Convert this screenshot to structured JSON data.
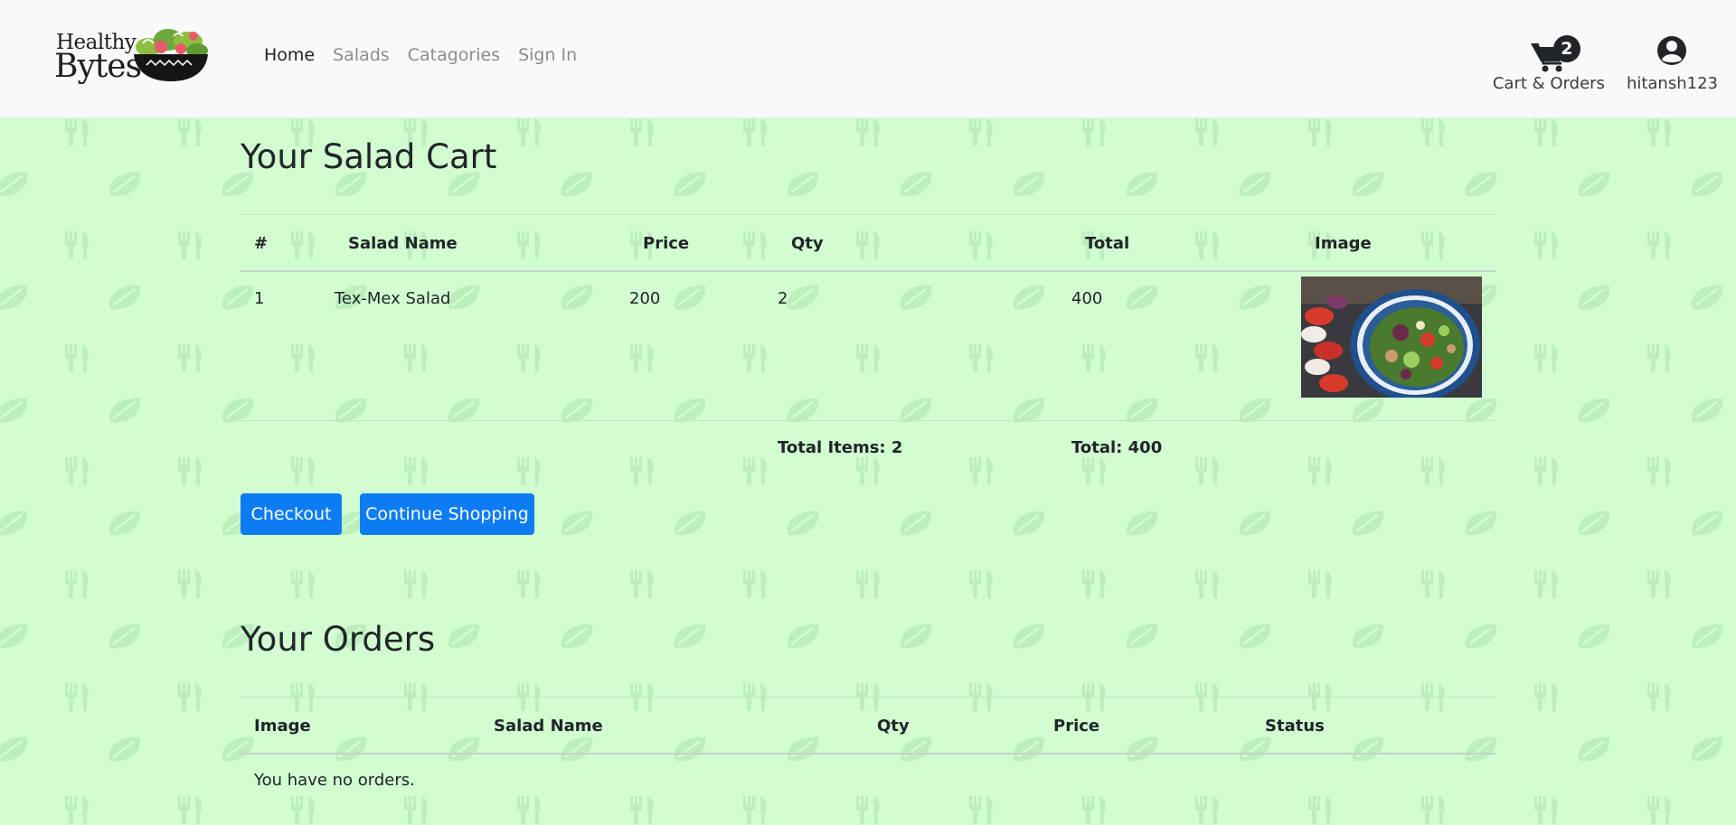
{
  "brand": {
    "line1": "Healthy",
    "line2": "Bytes"
  },
  "nav": {
    "links": [
      "Home",
      "Salads",
      "Catagories",
      "Sign In"
    ],
    "cart_label": "Cart & Orders",
    "cart_count": "2",
    "user_label": "hitansh123"
  },
  "cart": {
    "title": "Your Salad Cart",
    "headers": [
      "#",
      "Salad Name",
      "Price",
      "Qty",
      "Total",
      "Image"
    ],
    "rows": [
      {
        "num": "1",
        "name": "Tex-Mex Salad",
        "price": "200",
        "qty": "2",
        "total": "400"
      }
    ],
    "total_items": "Total Items: 2",
    "total": "Total: 400",
    "checkout_label": "Checkout",
    "continue_label": "Continue Shopping"
  },
  "orders": {
    "title": "Your Orders",
    "headers": [
      "Image",
      "Salad Name",
      "Qty",
      "Price",
      "Status"
    ],
    "empty_text": "You have no orders."
  },
  "colors": {
    "background": "#d1fdd1",
    "navbar": "#f8f9fb",
    "primary_button": "#0d7cf2",
    "pattern_icon": "#bdeebd"
  }
}
